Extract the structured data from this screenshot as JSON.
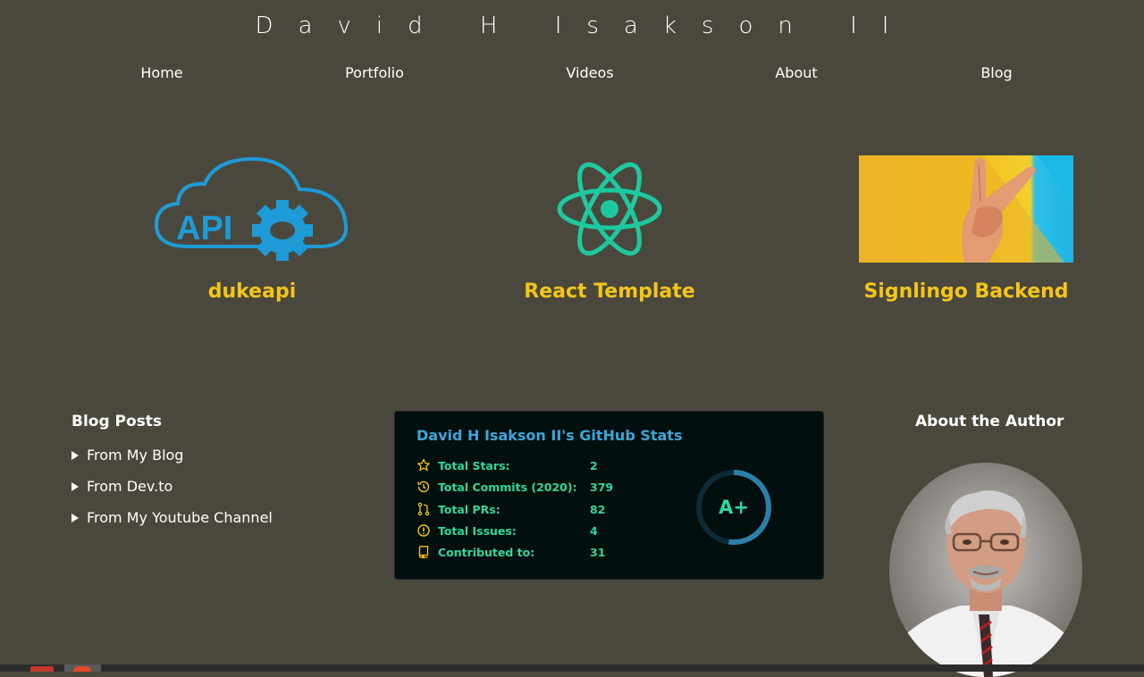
{
  "site": {
    "title": "David H Isakson II"
  },
  "nav": [
    {
      "label": "Home"
    },
    {
      "label": "Portfolio"
    },
    {
      "label": "Videos"
    },
    {
      "label": "About"
    },
    {
      "label": "Blog"
    }
  ],
  "projects": [
    {
      "name": "dukeapi",
      "icon": "api-cloud-gear-icon",
      "color": "#1e9bd7"
    },
    {
      "name": "React Template",
      "icon": "react-atom-icon",
      "color": "#1ec9a0"
    },
    {
      "name": "Signlingo Backend",
      "icon": "peace-hand-photo"
    }
  ],
  "blog": {
    "heading": "Blog Posts",
    "items": [
      {
        "label": "From My Blog"
      },
      {
        "label": "From Dev.to"
      },
      {
        "label": "From My Youtube Channel"
      }
    ]
  },
  "github": {
    "title": "David H Isakson II's GitHub Stats",
    "stats": [
      {
        "label": "Total Stars:",
        "value": "2",
        "icon": "star-icon"
      },
      {
        "label": "Total Commits (2020):",
        "value": "379",
        "icon": "history-icon"
      },
      {
        "label": "Total PRs:",
        "value": "82",
        "icon": "pull-request-icon"
      },
      {
        "label": "Total Issues:",
        "value": "4",
        "icon": "issue-icon"
      },
      {
        "label": "Contributed to:",
        "value": "31",
        "icon": "repo-icon"
      }
    ],
    "grade": "A+",
    "colors": {
      "title": "#3aa7d9",
      "text": "#2ed89c",
      "icon": "#f5c518",
      "bg": "#020f0f"
    }
  },
  "about": {
    "heading": "About the Author"
  },
  "theme": {
    "accent": "#f5c518",
    "background": "#4a483d"
  }
}
